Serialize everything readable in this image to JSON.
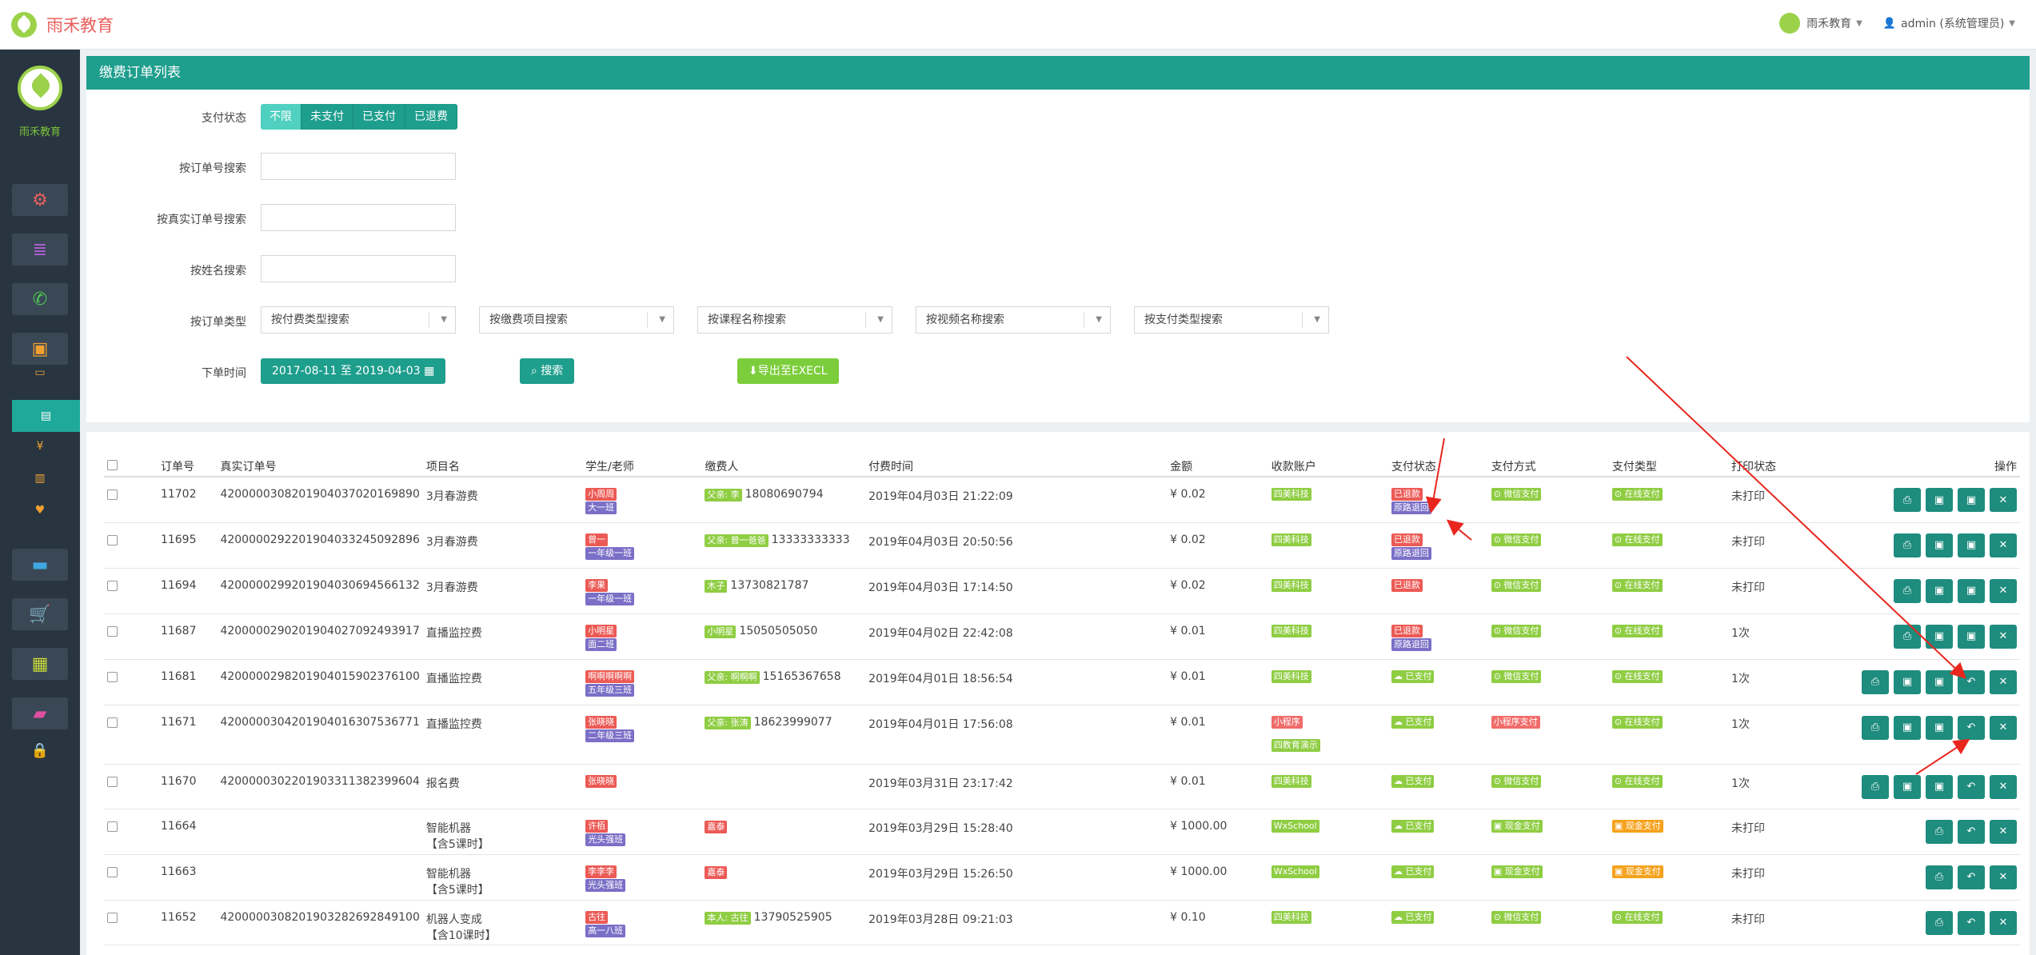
{
  "brand": {
    "name": "雨禾教育"
  },
  "topbar": {
    "org_menu": "雨禾教育",
    "user_menu": "admin (系统管理员)"
  },
  "sidebar": {
    "name": "雨禾教育"
  },
  "panel": {
    "title": "缴费订单列表"
  },
  "filters": {
    "pay_status_label": "支付状态",
    "pay_status_options": [
      "不限",
      "未支付",
      "已支付",
      "已退费"
    ],
    "order_no_label": "按订单号搜索",
    "real_order_no_label": "按真实订单号搜索",
    "name_label": "按姓名搜索",
    "order_type_label": "按订单类型",
    "selects": [
      "按付费类型搜索",
      "按缴费项目搜索",
      "按课程名称搜索",
      "按视频名称搜索",
      "按支付类型搜索"
    ],
    "order_time_label": "下单时间",
    "date_range": "2017-08-11 至 2019-04-03",
    "search_button": "搜索",
    "export_button": "导出至EXECL"
  },
  "table": {
    "headers": [
      "订单号",
      "真实订单号",
      "项目名",
      "学生/老师",
      "缴费人",
      "付费时间",
      "金额",
      "收款账户",
      "支付状态",
      "支付方式",
      "支付类型",
      "打印状态",
      "操作"
    ],
    "rows": [
      {
        "id": "11702",
        "real": "4200000308201904037020169890",
        "project": [
          "3月春游费"
        ],
        "student": [
          [
            "小周周",
            "red"
          ],
          [
            "大一班",
            "purple"
          ]
        ],
        "payer": [
          [
            "父亲: 李",
            "green"
          ]
        ],
        "payer_phone": "18080690794",
        "time": "2019年04月03日 21:22:09",
        "amount": "¥ 0.02",
        "account": [
          [
            "四美科技",
            "green"
          ]
        ],
        "status": [
          [
            "已退款",
            "red"
          ],
          [
            "原路退回",
            "purple"
          ]
        ],
        "method": [
          [
            "⊙ 微信支付",
            "green"
          ]
        ],
        "ptype": [
          [
            "⊙ 在线支付",
            "green"
          ]
        ],
        "print": "未打印",
        "ops": 4
      },
      {
        "id": "11695",
        "real": "4200000292201904033245092896",
        "project": [
          "3月春游费"
        ],
        "student": [
          [
            "曾一",
            "red"
          ],
          [
            "一年级一班",
            "purple"
          ]
        ],
        "payer": [
          [
            "父亲: 曾一爸爸",
            "green"
          ]
        ],
        "payer_phone": "13333333333",
        "time": "2019年04月03日 20:50:56",
        "amount": "¥ 0.02",
        "account": [
          [
            "四美科技",
            "green"
          ]
        ],
        "status": [
          [
            "已退款",
            "red"
          ],
          [
            "原路退回",
            "purple"
          ]
        ],
        "method": [
          [
            "⊙ 微信支付",
            "green"
          ]
        ],
        "ptype": [
          [
            "⊙ 在线支付",
            "green"
          ]
        ],
        "print": "未打印",
        "ops": 4
      },
      {
        "id": "11694",
        "real": "4200000299201904030694566132",
        "project": [
          "3月春游费"
        ],
        "student": [
          [
            "李果",
            "red"
          ],
          [
            "一年级一班",
            "purple"
          ]
        ],
        "payer": [
          [
            "木子",
            "green"
          ]
        ],
        "payer_phone": "13730821787",
        "time": "2019年04月03日 17:14:50",
        "amount": "¥ 0.02",
        "account": [
          [
            "四美科技",
            "green"
          ]
        ],
        "status": [
          [
            "已退款",
            "red"
          ]
        ],
        "method": [
          [
            "⊙ 微信支付",
            "green"
          ]
        ],
        "ptype": [
          [
            "⊙ 在线支付",
            "green"
          ]
        ],
        "print": "未打印",
        "ops": 4
      },
      {
        "id": "11687",
        "real": "4200000290201904027092493917",
        "project": [
          "直播监控费"
        ],
        "student": [
          [
            "小明星",
            "red"
          ],
          [
            "面二班",
            "purple"
          ]
        ],
        "payer": [
          [
            "小明星",
            "green"
          ]
        ],
        "payer_phone": "15050505050",
        "time": "2019年04月02日 22:42:08",
        "amount": "¥ 0.01",
        "account": [
          [
            "四美科技",
            "green"
          ]
        ],
        "status": [
          [
            "已退款",
            "red"
          ],
          [
            "原路退回",
            "purple"
          ]
        ],
        "method": [
          [
            "⊙ 微信支付",
            "green"
          ]
        ],
        "ptype": [
          [
            "⊙ 在线支付",
            "green"
          ]
        ],
        "print": "1次",
        "ops": 4
      },
      {
        "id": "11681",
        "real": "4200000298201904015902376100",
        "project": [
          "直播监控费"
        ],
        "student": [
          [
            "啊啊啊啊啊",
            "red"
          ],
          [
            "五年级三班",
            "purple"
          ]
        ],
        "payer": [
          [
            "父亲: 啊啊啊",
            "green"
          ]
        ],
        "payer_phone": "15165367658",
        "time": "2019年04月01日 18:56:54",
        "amount": "¥ 0.01",
        "account": [
          [
            "四美科技",
            "green"
          ]
        ],
        "status": [
          [
            "☁ 已支付",
            "green"
          ]
        ],
        "method": [
          [
            "⊙ 微信支付",
            "green"
          ]
        ],
        "ptype": [
          [
            "⊙ 在线支付",
            "green"
          ]
        ],
        "print": "1次",
        "ops": 5
      },
      {
        "id": "11671",
        "real": "4200000304201904016307536771",
        "project": [
          "直播监控费"
        ],
        "student": [
          [
            "张晓晓",
            "red"
          ],
          [
            "二年级三班",
            "purple"
          ]
        ],
        "payer": [
          [
            "父亲: 张涛",
            "green"
          ]
        ],
        "payer_phone": "18623999077",
        "time": "2019年04月01日 17:56:08",
        "amount": "¥ 0.01",
        "account": [
          [
            "小程序",
            "pink"
          ],
          [
            "四教育演示",
            "green"
          ]
        ],
        "status": [
          [
            "☁ 已支付",
            "green"
          ]
        ],
        "method": [
          [
            "小程序支付",
            "pink"
          ]
        ],
        "ptype": [
          [
            "⊙ 在线支付",
            "green"
          ]
        ],
        "print": "1次",
        "ops": 5
      },
      {
        "id": "11670",
        "real": "4200000302201903311382399604",
        "project": [
          "报名费"
        ],
        "student": [
          [
            "张晓晓",
            "red"
          ]
        ],
        "payer": [],
        "payer_phone": "",
        "time": "2019年03月31日 23:17:42",
        "amount": "¥ 0.01",
        "account": [
          [
            "四美科技",
            "green"
          ]
        ],
        "status": [
          [
            "☁ 已支付",
            "green"
          ]
        ],
        "method": [
          [
            "⊙ 微信支付",
            "green"
          ]
        ],
        "ptype": [
          [
            "⊙ 在线支付",
            "green"
          ]
        ],
        "print": "1次",
        "ops": 5
      },
      {
        "id": "11664",
        "real": "",
        "project": [
          "智能机器",
          "【含5课时】"
        ],
        "student": [
          [
            "许栢",
            "red"
          ],
          [
            "光头强班",
            "purple"
          ]
        ],
        "payer": [
          [
            "嘉泰",
            "red"
          ]
        ],
        "payer_phone": "",
        "time": "2019年03月29日 15:28:40",
        "amount": "¥ 1000.00",
        "account": [
          [
            "WxSchool",
            "green"
          ]
        ],
        "status": [
          [
            "☁ 已支付",
            "green"
          ]
        ],
        "method": [
          [
            "▣ 现金支付",
            "green"
          ]
        ],
        "ptype": [
          [
            "▣ 现金支付",
            "orange"
          ]
        ],
        "print": "未打印",
        "ops": 3
      },
      {
        "id": "11663",
        "real": "",
        "project": [
          "智能机器",
          "【含5课时】"
        ],
        "student": [
          [
            "李李李",
            "red"
          ],
          [
            "光头强班",
            "purple"
          ]
        ],
        "payer": [
          [
            "嘉泰",
            "red"
          ]
        ],
        "payer_phone": "",
        "time": "2019年03月29日 15:26:50",
        "amount": "¥ 1000.00",
        "account": [
          [
            "WxSchool",
            "green"
          ]
        ],
        "status": [
          [
            "☁ 已支付",
            "green"
          ]
        ],
        "method": [
          [
            "▣ 现金支付",
            "green"
          ]
        ],
        "ptype": [
          [
            "▣ 现金支付",
            "orange"
          ]
        ],
        "print": "未打印",
        "ops": 3
      },
      {
        "id": "11652",
        "real": "4200000308201903282692849100",
        "project": [
          "机器人变成",
          "【含10课时】"
        ],
        "student": [
          [
            "古往",
            "red"
          ],
          [
            "高一八班",
            "purple"
          ]
        ],
        "payer": [
          [
            "本人: 古往",
            "green"
          ]
        ],
        "payer_phone": "13790525905",
        "time": "2019年03月28日 09:21:03",
        "amount": "¥ 0.10",
        "account": [
          [
            "四美科技",
            "green"
          ]
        ],
        "status": [
          [
            "☁ 已支付",
            "green"
          ]
        ],
        "method": [
          [
            "⊙ 微信支付",
            "green"
          ]
        ],
        "ptype": [
          [
            "⊙ 在线支付",
            "green"
          ]
        ],
        "print": "未打印",
        "ops": 3
      }
    ]
  },
  "icons": {
    "settings": "gear-icon",
    "database": "database-icon",
    "wechat": "wechat-icon",
    "money": "money-icon",
    "card": "card-icon",
    "cart": "cart-icon",
    "calc": "calculator-icon",
    "book": "book-icon",
    "lock": "lock-icon"
  },
  "colors": {
    "teal": "#1e9e8d",
    "red": "#ec5a55",
    "purple": "#7b6fc7",
    "green": "#8fcd43",
    "orange": "#f5a21d",
    "sidebar": "#283541"
  }
}
